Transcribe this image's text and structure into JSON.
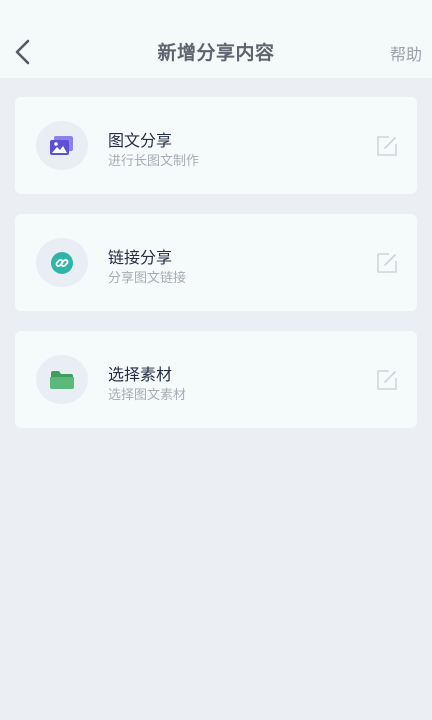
{
  "header": {
    "title": "新增分享内容",
    "help_label": "帮助",
    "back_icon": "chevron-left-icon"
  },
  "cards": [
    {
      "title": "图文分享",
      "subtitle": "进行长图文制作",
      "icon": "image-gallery-icon",
      "icon_color": "#5b50d6"
    },
    {
      "title": "链接分享",
      "subtitle": "分享图文链接",
      "icon": "link-icon",
      "icon_color": "#2fb5a8"
    },
    {
      "title": "选择素材",
      "subtitle": "选择图文素材",
      "icon": "folder-icon",
      "icon_color": "#5cb87a"
    }
  ],
  "edit_icon": "edit-icon",
  "colors": {
    "page_background": "#ebeff4",
    "card_background": "#f5fbfb",
    "title_text": "#242e44",
    "subtitle_text": "#a7acb3"
  }
}
